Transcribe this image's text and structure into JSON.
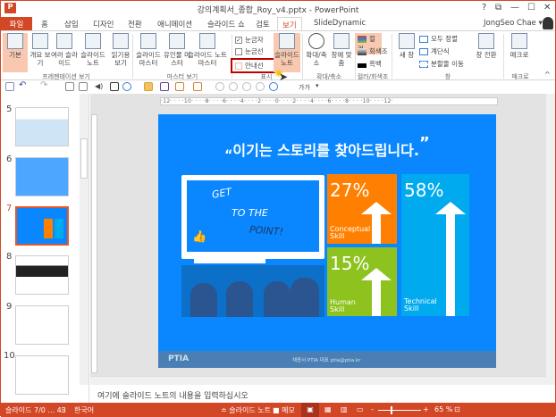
{
  "window": {
    "title": "강의계획서_종합_Roy_v4.pptx - PowerPoint",
    "help": "?",
    "restore_ribbon": "⧉",
    "minimize": "—",
    "maximize": "☐",
    "close": "✕",
    "user": "JongSeo Chae ▾"
  },
  "tabs": [
    "파일",
    "홈",
    "삽입",
    "디자인",
    "전환",
    "애니메이션",
    "슬라이드 쇼",
    "검토",
    "보기",
    "SlideDynamic"
  ],
  "ribbon": {
    "presentation_views": {
      "label": "프레젠테이션 보기",
      "buttons": [
        "기본",
        "개요 보기",
        "여러 슬라이드",
        "슬라이드 노트",
        "읽기용 보기"
      ]
    },
    "master_views": {
      "label": "마스터 보기",
      "buttons": [
        "슬라이드 마스터",
        "유인물 마스터",
        "슬라이드 노트 마스터"
      ]
    },
    "show": {
      "label": "표시",
      "ruler": "눈금자",
      "gridlines": "눈금선",
      "guides": "안내선",
      "ruler_checked": true,
      "gridlines_checked": false,
      "guides_checked": false,
      "notes_button": "슬라이드 노트"
    },
    "zoom": {
      "label": "확대/축소",
      "buttons": [
        "확대/축소",
        "창에 맞춤"
      ]
    },
    "color": {
      "label": "컬러/회색조",
      "items": [
        "컬러",
        "회색조",
        "흑백"
      ],
      "colors": [
        "#3a7bd5",
        "#555555",
        "#000000"
      ]
    },
    "window": {
      "label": "창",
      "new_window": "새 창",
      "items": [
        "모두 정렬",
        "계단식",
        "분할줄 이동"
      ],
      "switch": "창 전환"
    },
    "macro": {
      "label": "매크로",
      "button": "매크로"
    }
  },
  "qat": {
    "font_label": "가가"
  },
  "ruler_text": "·12· · · ·10· · · ·8· · · ·6· · · ·4· · · ·2· · · ·0· · · ·2· · · ·4· · · ·6· · · ·8· · · ·10· · · ·12·",
  "slides": [
    {
      "num": "5"
    },
    {
      "num": "6"
    },
    {
      "num": "7",
      "selected": true
    },
    {
      "num": "8"
    },
    {
      "num": "9"
    },
    {
      "num": "10"
    }
  ],
  "slide": {
    "title": "이기는 스토리를 찾아드립니다.",
    "open_quote": "“",
    "close_quote": "”",
    "tv_text": [
      "GET",
      "TO THE",
      "POINT!"
    ],
    "boxes": [
      {
        "pct": "27%",
        "label": [
          "Conceptual",
          "Skill"
        ],
        "color": "#ff8000"
      },
      {
        "pct": "15%",
        "label": [
          "Human",
          "Skill"
        ],
        "color": "#8dc21f"
      },
      {
        "pct": "58%",
        "label": [
          "Technical",
          "Skill"
        ],
        "color": "#00aaee"
      }
    ],
    "footer_brand": "PTIA",
    "footer_text": "채종서 PTIA 대표 ptia@ptia.kr"
  },
  "notes_placeholder": "여기에 슬라이드 노트의 내용을 입력하십시오",
  "status": {
    "slide": "슬라이드 7/0 ... 43",
    "language": "한국어",
    "notes": "≐ 슬라이드 노트",
    "comments": "■ 메모",
    "zoom": "65 %",
    "zoom_value": 65
  }
}
